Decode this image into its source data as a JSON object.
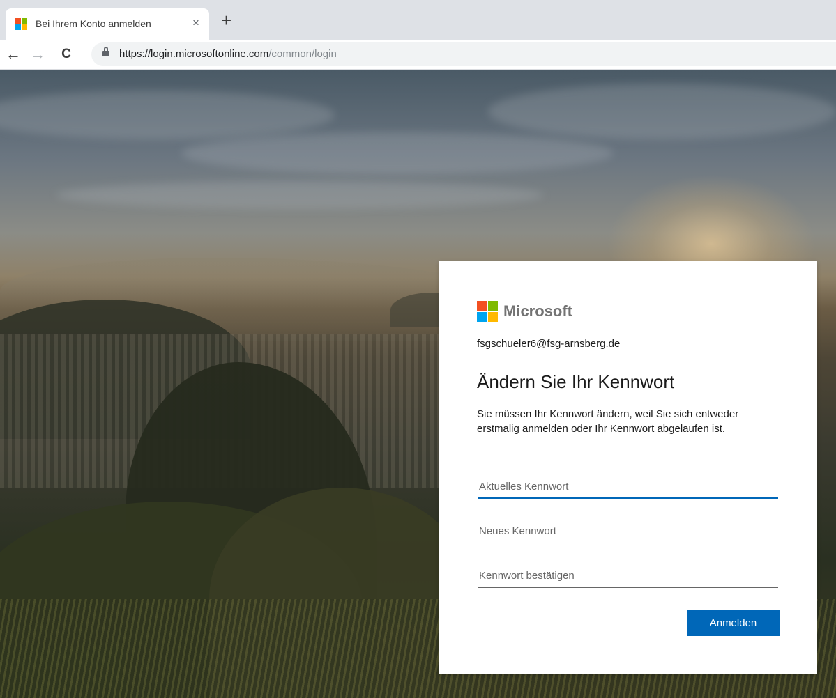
{
  "browser": {
    "tab": {
      "title": "Bei Ihrem Konto anmelden",
      "close_glyph": "×",
      "favicon": "microsoft-logo-icon"
    },
    "newtab_glyph": "+",
    "nav": {
      "back_glyph": "←",
      "forward_glyph": "→",
      "reload_glyph": "C"
    },
    "url": {
      "host": "https://login.microsoftonline.com",
      "path": "/common/login"
    }
  },
  "card": {
    "logo_text": "Microsoft",
    "logo_colors": [
      "#f25022",
      "#7fba00",
      "#00a4ef",
      "#ffb900"
    ],
    "identity": "fsgschueler6@fsg-arnsberg.de",
    "heading": "Ändern Sie Ihr Kennwort",
    "description": "Sie müssen Ihr Kennwort ändern, weil Sie sich entweder erstmalig anmelden oder Ihr Kennwort abgelaufen ist.",
    "fields": {
      "current": {
        "placeholder": "Aktuelles Kennwort",
        "value": ""
      },
      "new": {
        "placeholder": "Neues Kennwort",
        "value": ""
      },
      "confirm": {
        "placeholder": "Kennwort bestätigen",
        "value": ""
      }
    },
    "submit_label": "Anmelden"
  },
  "colors": {
    "accent": "#0067b8",
    "chrome_bg": "#dee1e6",
    "omnibox_bg": "#f1f3f4"
  }
}
